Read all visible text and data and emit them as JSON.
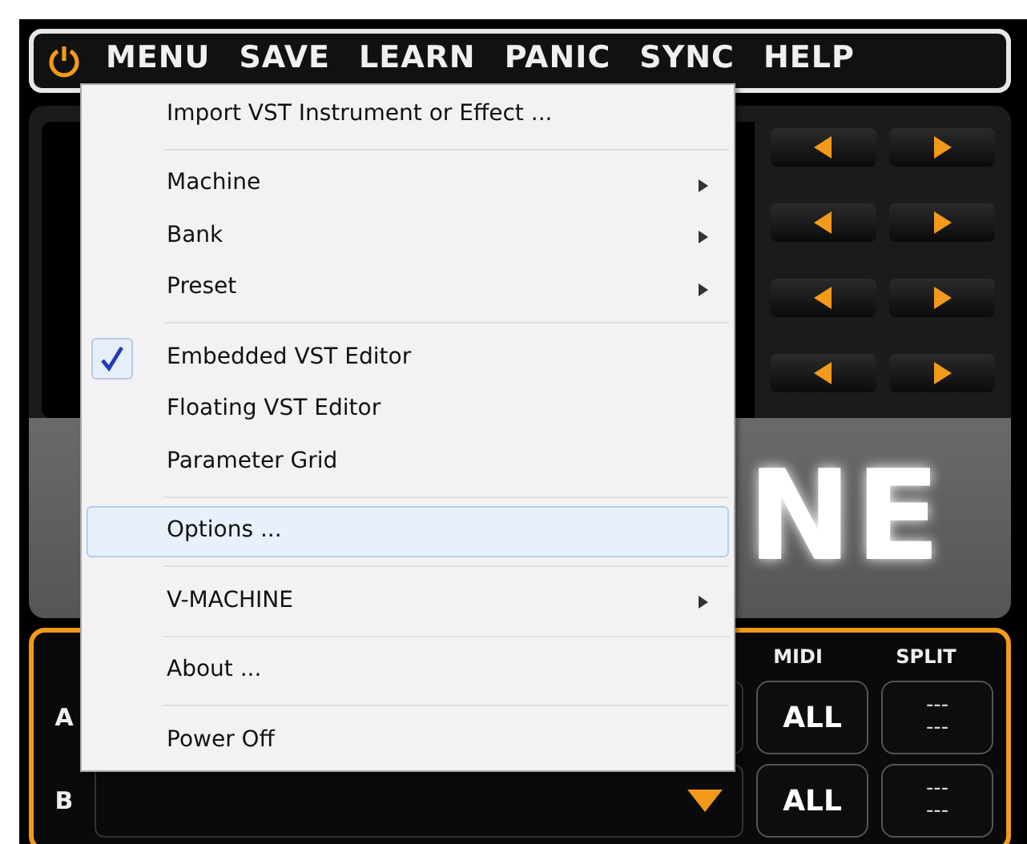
{
  "toolbar": {
    "items": [
      "MENU",
      "SAVE",
      "LEARN",
      "PANIC",
      "SYNC",
      "HELP"
    ]
  },
  "display": {
    "logo_text": "NE"
  },
  "parts": {
    "headers": [
      "MIDI",
      "SPLIT"
    ],
    "rows": [
      {
        "label": "A",
        "midi": "ALL",
        "split": [
          "---",
          "---"
        ],
        "arrow": false
      },
      {
        "label": "B",
        "midi": "ALL",
        "split": [
          "---",
          "---"
        ],
        "arrow": true
      }
    ]
  },
  "menu": {
    "items": [
      {
        "kind": "item",
        "label": "Import VST Instrument or Effect ...",
        "checked": false,
        "submenu": false,
        "selected": false
      },
      {
        "kind": "separator"
      },
      {
        "kind": "item",
        "label": "Machine",
        "checked": false,
        "submenu": true,
        "selected": false
      },
      {
        "kind": "item",
        "label": "Bank",
        "checked": false,
        "submenu": true,
        "selected": false
      },
      {
        "kind": "item",
        "label": "Preset",
        "checked": false,
        "submenu": true,
        "selected": false
      },
      {
        "kind": "separator"
      },
      {
        "kind": "item",
        "label": "Embedded VST Editor",
        "checked": true,
        "submenu": false,
        "selected": false
      },
      {
        "kind": "item",
        "label": "Floating VST Editor",
        "checked": false,
        "submenu": false,
        "selected": false
      },
      {
        "kind": "item",
        "label": "Parameter Grid",
        "checked": false,
        "submenu": false,
        "selected": false
      },
      {
        "kind": "separator"
      },
      {
        "kind": "item",
        "label": "Options ...",
        "checked": false,
        "submenu": false,
        "selected": true
      },
      {
        "kind": "separator"
      },
      {
        "kind": "item",
        "label": "V-MACHINE",
        "checked": false,
        "submenu": true,
        "selected": false
      },
      {
        "kind": "separator"
      },
      {
        "kind": "item",
        "label": "About ...",
        "checked": false,
        "submenu": false,
        "selected": false
      },
      {
        "kind": "separator"
      },
      {
        "kind": "item",
        "label": "Power Off",
        "checked": false,
        "submenu": false,
        "selected": false
      }
    ]
  }
}
